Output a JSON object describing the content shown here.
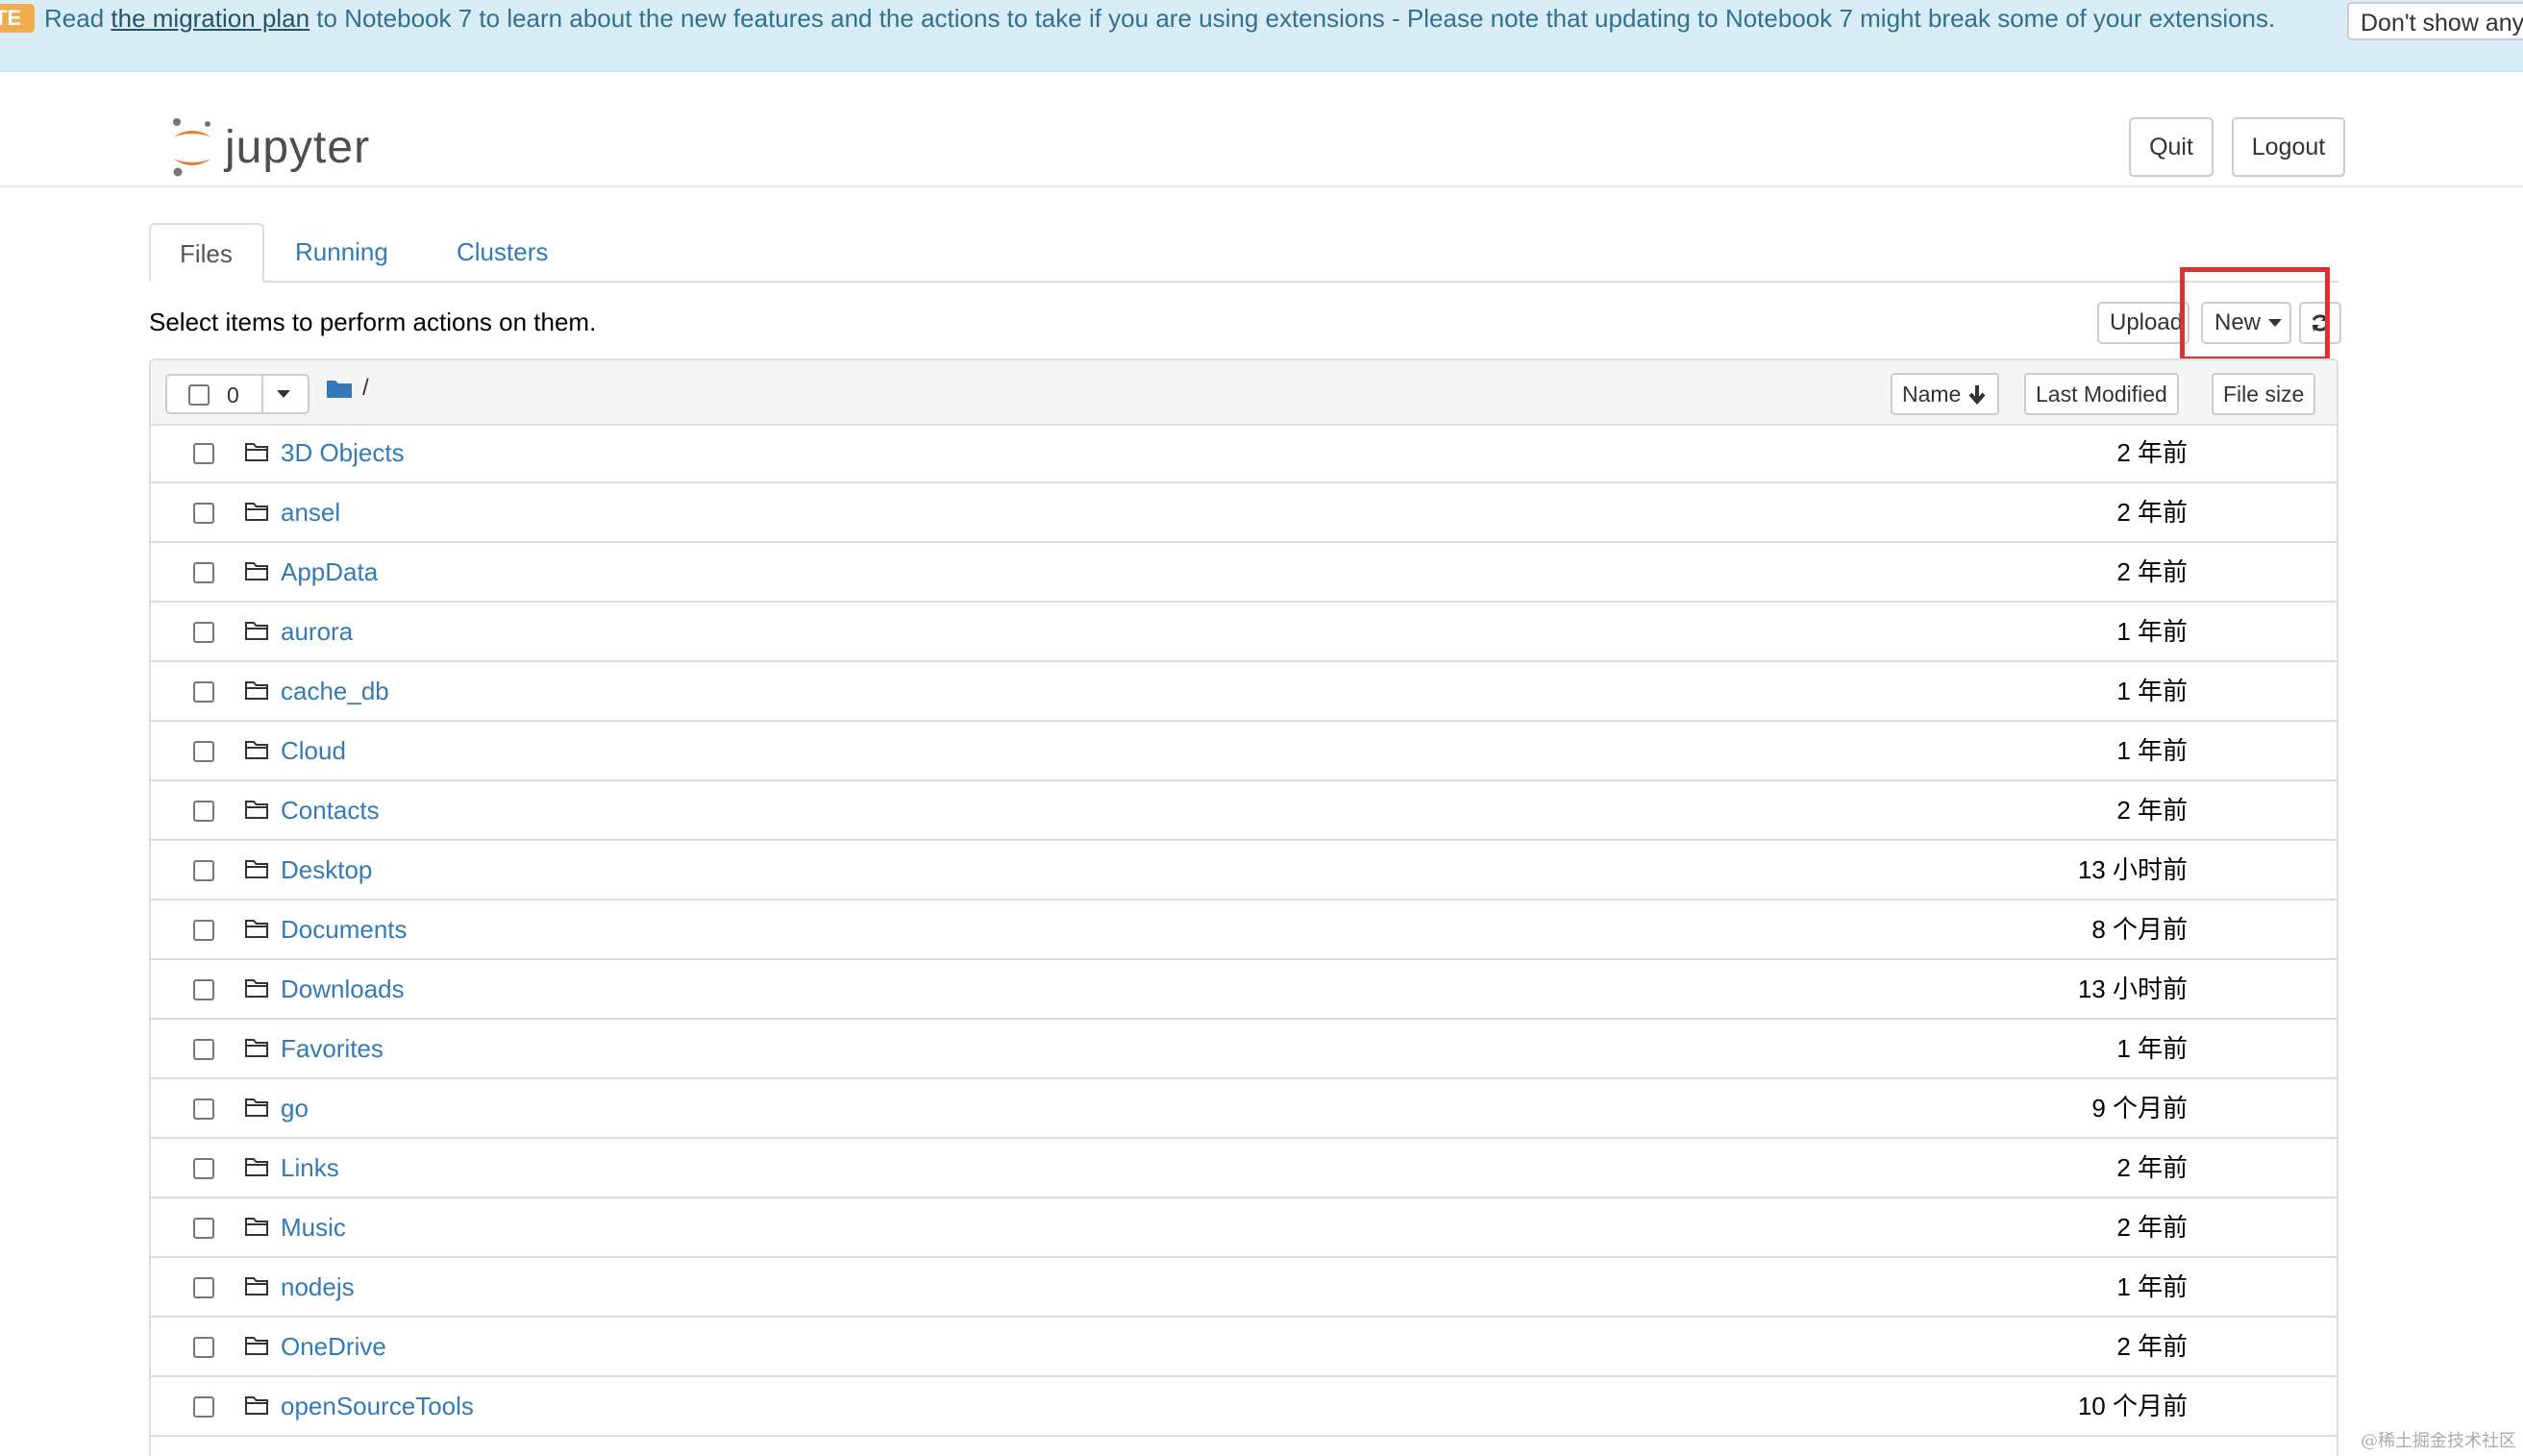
{
  "banner": {
    "badge": "TE",
    "text_before": "Read ",
    "link": "the migration plan",
    "text_after": " to Notebook 7 to learn about the new features and the actions to take if you are using extensions - Please note that updating to Notebook 7 might break some of your extensions.",
    "dismiss": "Don't show anymore",
    "color": "#d9edf7"
  },
  "header": {
    "logo_text": "jupyter",
    "quit": "Quit",
    "logout": "Logout"
  },
  "tabs": [
    "Files",
    "Running",
    "Clusters"
  ],
  "toolbar": {
    "hint": "Select items to perform actions on them.",
    "upload": "Upload",
    "new": "New",
    "highlight_color": "#e03131"
  },
  "list_header": {
    "selected_count": "0",
    "path": "/",
    "sort_name": "Name",
    "sort_modified": "Last Modified",
    "sort_size": "File size"
  },
  "files": [
    {
      "name": "3D Objects",
      "modified": "2 年前"
    },
    {
      "name": "ansel",
      "modified": "2 年前"
    },
    {
      "name": "AppData",
      "modified": "2 年前"
    },
    {
      "name": "aurora",
      "modified": "1 年前"
    },
    {
      "name": "cache_db",
      "modified": "1 年前"
    },
    {
      "name": "Cloud",
      "modified": "1 年前"
    },
    {
      "name": "Contacts",
      "modified": "2 年前"
    },
    {
      "name": "Desktop",
      "modified": "13 小时前"
    },
    {
      "name": "Documents",
      "modified": "8 个月前"
    },
    {
      "name": "Downloads",
      "modified": "13 小时前"
    },
    {
      "name": "Favorites",
      "modified": "1 年前"
    },
    {
      "name": "go",
      "modified": "9 个月前"
    },
    {
      "name": "Links",
      "modified": "2 年前"
    },
    {
      "name": "Music",
      "modified": "2 年前"
    },
    {
      "name": "nodejs",
      "modified": "1 年前"
    },
    {
      "name": "OneDrive",
      "modified": "2 年前"
    },
    {
      "name": "openSourceTools",
      "modified": "10 个月前"
    }
  ],
  "watermark": "@稀土掘金技术社区"
}
